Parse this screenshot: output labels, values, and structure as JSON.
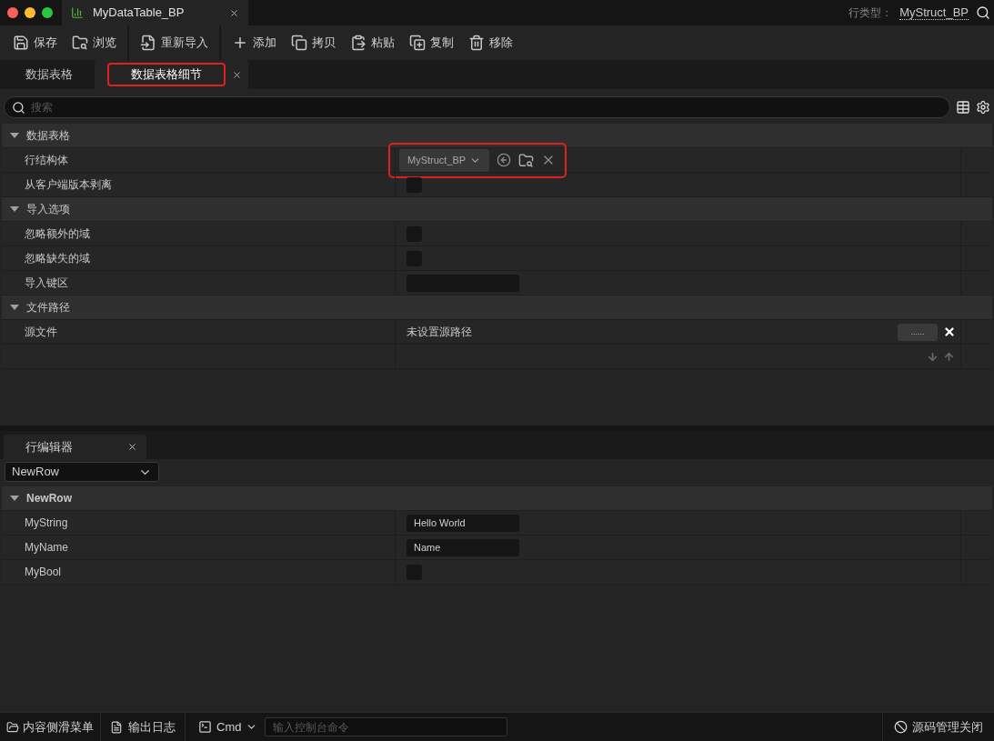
{
  "window": {
    "tab_title": "MyDataTable_BP",
    "row_type_label": "行类型：",
    "row_type_value": "MyStruct_BP"
  },
  "toolbar": [
    {
      "kind": "save",
      "label": "保存",
      "separator_after": false
    },
    {
      "kind": "browse",
      "label": "浏览",
      "separator_after": true
    },
    {
      "kind": "reimport",
      "label": "重新导入",
      "separator_after": true
    },
    {
      "kind": "add",
      "label": "添加",
      "separator_after": false
    },
    {
      "kind": "copy",
      "label": "拷贝",
      "separator_after": false
    },
    {
      "kind": "paste",
      "label": "粘贴",
      "separator_after": false
    },
    {
      "kind": "duplicate",
      "label": "复制",
      "separator_after": false
    },
    {
      "kind": "remove",
      "label": "移除",
      "separator_after": false
    }
  ],
  "tabs": [
    {
      "label": "数据表格",
      "selected": false,
      "highlighted": false,
      "closable": false
    },
    {
      "label": "数据表格细节",
      "selected": true,
      "highlighted": true,
      "closable": true
    }
  ],
  "search": {
    "placeholder": "搜索"
  },
  "details": [
    {
      "title": "数据表格",
      "expanded": true,
      "rows": [
        {
          "kind": "struct",
          "label": "行结构体",
          "value": "MyStruct_BP",
          "highlighted": true
        },
        {
          "kind": "checkbox",
          "label": "从客户端版本剥离",
          "checked": false
        }
      ]
    },
    {
      "title": "导入选项",
      "expanded": true,
      "rows": [
        {
          "kind": "checkbox",
          "label": "忽略额外的域",
          "checked": false
        },
        {
          "kind": "checkbox",
          "label": "忽略缺失的域",
          "checked": false
        },
        {
          "kind": "text",
          "label": "导入键区",
          "value": ""
        }
      ]
    },
    {
      "title": "文件路径",
      "expanded": true,
      "rows": [
        {
          "kind": "file",
          "label": "源文件",
          "value": "未设置源路径",
          "button": "......"
        },
        {
          "kind": "reorder"
        }
      ]
    }
  ],
  "row_editor": {
    "tab": "行编辑器",
    "row_select": "NewRow",
    "section": {
      "title": "NewRow",
      "expanded": true,
      "rows": [
        {
          "kind": "text",
          "label": "MyString",
          "value": "Hello World"
        },
        {
          "kind": "text",
          "label": "MyName",
          "value": "Name"
        },
        {
          "kind": "checkbox",
          "label": "MyBool",
          "checked": false
        }
      ]
    }
  },
  "status_bar": {
    "content_drawer": "内容侧滑菜单",
    "output_log": "输出日志",
    "cmd": "Cmd",
    "console_placeholder": "输入控制台命令",
    "source_control": "源码管理关闭"
  }
}
